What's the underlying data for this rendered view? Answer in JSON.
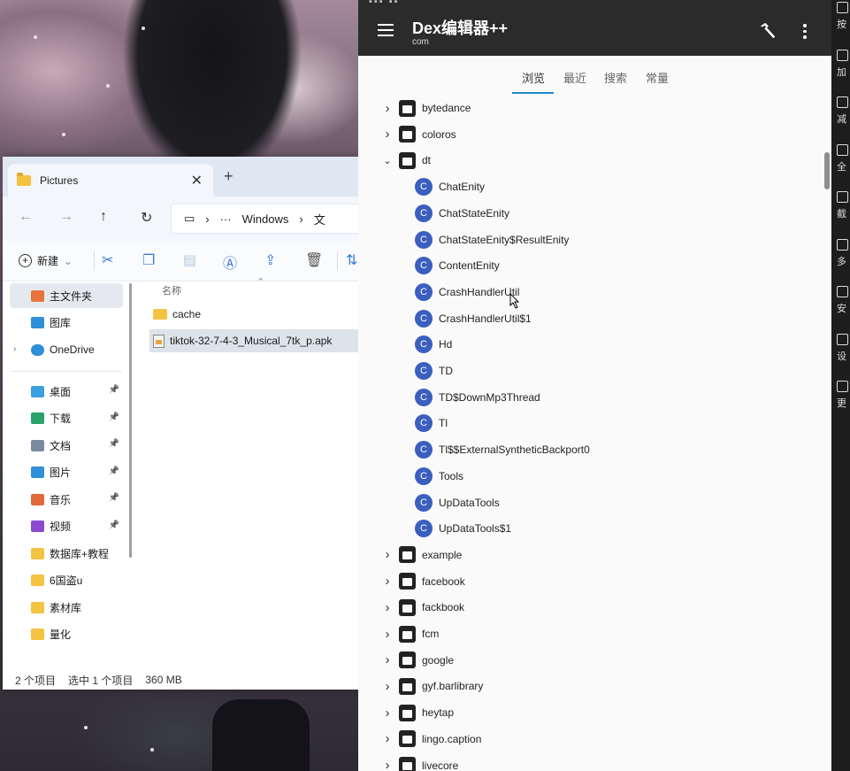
{
  "explorer": {
    "tab_title": "Pictures",
    "tab_close": "✕",
    "new_tab": "+",
    "breadcrumb": {
      "ellipsis": "···",
      "segment1": "Windows",
      "separator": "›",
      "segment2": "文"
    },
    "toolbar": {
      "new_label": "新建",
      "new_caret": "⌄"
    },
    "sidebar": {
      "home": "主文件夹",
      "gallery": "图库",
      "onedrive": "OneDrive",
      "items": [
        {
          "label": "桌面",
          "color": "#3aa0e0"
        },
        {
          "label": "下载",
          "color": "#2aa36a"
        },
        {
          "label": "文档",
          "color": "#7a8aa0"
        },
        {
          "label": "图片",
          "color": "#2f8fd8"
        },
        {
          "label": "音乐",
          "color": "#e06a3a"
        },
        {
          "label": "视频",
          "color": "#8a4ad0"
        },
        {
          "label": "数据库+教程",
          "color": "#f5c342"
        },
        {
          "label": "6国盗u",
          "color": "#f5c342"
        },
        {
          "label": "素材库",
          "color": "#f5c342"
        },
        {
          "label": "量化",
          "color": "#f5c342"
        }
      ]
    },
    "content": {
      "column_name": "名称",
      "files": [
        {
          "name": "cache",
          "type": "folder"
        },
        {
          "name": "tiktok-32-7-4-3_Musical_7tk_p.apk",
          "type": "apk"
        }
      ]
    },
    "status": {
      "count": "2 个项目",
      "selected": "选中 1 个项目",
      "size": "360 MB"
    }
  },
  "app": {
    "title": "Dex编辑器++",
    "subtitle": "com",
    "tabs": [
      "浏览",
      "最近",
      "搜索",
      "常量"
    ],
    "active_tab": "浏览",
    "packages_before": [
      "bytedance",
      "coloros"
    ],
    "expanded_package": "dt",
    "classes": [
      "ChatEnity",
      "ChatStateEnity",
      "ChatStateEnity$ResultEnity",
      "ContentEnity",
      "CrashHandlerUtil",
      "CrashHandlerUtil$1",
      "Hd",
      "TD",
      "TD$DownMp3Thread",
      "Tl",
      "Tl$$ExternalSyntheticBackport0",
      "Tools",
      "UpDataTools",
      "UpDataTools$1"
    ],
    "class_badge": "C",
    "packages_after": [
      "example",
      "facebook",
      "fackbook",
      "fcm",
      "google",
      "gyf.barlibrary",
      "heytap",
      "lingo.caption",
      "livecore"
    ],
    "accent_color": "#1e88c8"
  },
  "emulator_sidebar": [
    "按",
    "加",
    "减",
    "全",
    "截",
    "多",
    "安",
    "设",
    "更"
  ]
}
